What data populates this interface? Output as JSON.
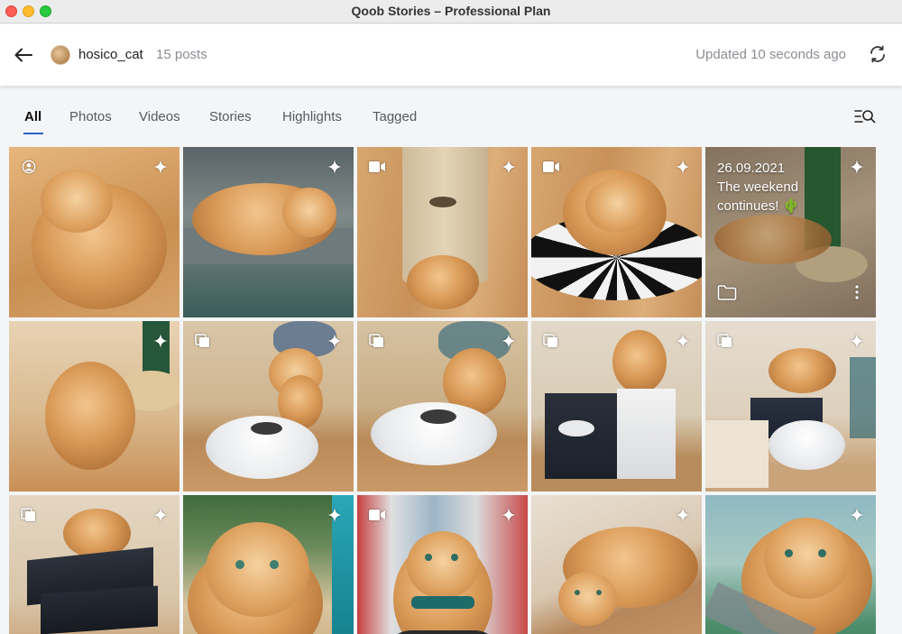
{
  "window": {
    "title": "Qoob Stories – Professional Plan"
  },
  "header": {
    "username": "hosico_cat",
    "post_count": "15 posts",
    "updated": "Updated 10 seconds ago"
  },
  "tabs": [
    {
      "label": "All",
      "active": true
    },
    {
      "label": "Photos",
      "active": false
    },
    {
      "label": "Videos",
      "active": false
    },
    {
      "label": "Stories",
      "active": false
    },
    {
      "label": "Highlights",
      "active": false
    },
    {
      "label": "Tagged",
      "active": false
    }
  ],
  "grid": {
    "tiles": [
      {
        "type": "profile",
        "starred": true
      },
      {
        "type": "photo",
        "starred": true
      },
      {
        "type": "video",
        "starred": true
      },
      {
        "type": "video",
        "starred": true
      },
      {
        "type": "story",
        "starred": true,
        "story_date": "26.09.2021",
        "story_caption": "The weekend continues! 🌵"
      },
      {
        "type": "photo",
        "starred": true
      },
      {
        "type": "carousel",
        "starred": true
      },
      {
        "type": "carousel",
        "starred": true
      },
      {
        "type": "carousel",
        "starred": true
      },
      {
        "type": "carousel",
        "starred": true
      },
      {
        "type": "carousel",
        "starred": true
      },
      {
        "type": "photo",
        "starred": true
      },
      {
        "type": "video",
        "starred": true
      },
      {
        "type": "photo",
        "starred": true
      },
      {
        "type": "photo",
        "starred": true
      }
    ]
  },
  "colors": {
    "accent": "#2b5fc9",
    "muted_text": "#8a8d93"
  },
  "icons": [
    "back-arrow-icon",
    "refresh-icon",
    "filter-search-icon",
    "profile-icon",
    "video-icon",
    "carousel-icon",
    "sparkle-icon",
    "folder-icon",
    "more-vertical-icon"
  ]
}
